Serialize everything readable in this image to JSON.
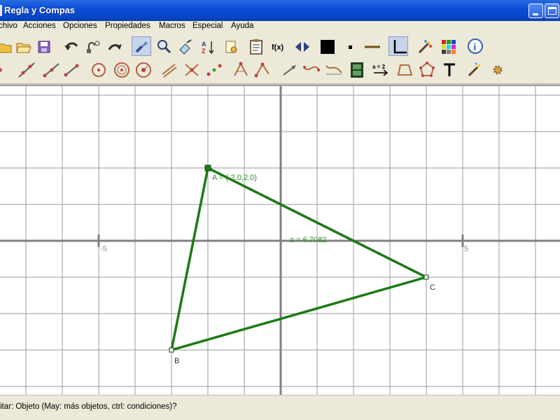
{
  "window": {
    "title": "Regla y Compas"
  },
  "menu": [
    "chivo",
    "Acciones",
    "Opciones",
    "Propiedades",
    "Macros",
    "Especial",
    "Ayuda"
  ],
  "toolbar": {
    "row1": [
      "open-icon",
      "folder-icon",
      "save-icon",
      "undo-icon",
      "hide-icon",
      "redo-icon",
      "edit-tool-icon",
      "zoom-move-icon",
      "label-tool-icon",
      "sort-icon",
      "properties-icon",
      "notes-icon",
      "function-icon",
      "reverse-icon",
      "color-icon",
      "point-size-icon",
      "line-thickness-icon",
      "axes-icon",
      "magic-wand-icon",
      "color-palette-icon",
      "info-icon"
    ],
    "row2": [
      "point-icon",
      "line-icon",
      "ray-icon",
      "segment-icon",
      "circle-icon",
      "fixed-circle-icon",
      "compass-circle-icon",
      "parallel-icon",
      "intersection-icon",
      "midpoint-icon",
      "angle-icon",
      "fixed-angle-icon",
      "vector-icon",
      "curve-icon",
      "function-plot-icon",
      "animation-icon",
      "expression-icon",
      "polygon-icon",
      "polygon-points-icon",
      "text-tool-icon",
      "hammer-tool-icon",
      "settings-gear-icon"
    ],
    "function_label": "f(x)",
    "expression_label": "a = 2"
  },
  "canvas": {
    "x_tick_neg": "-5",
    "x_tick_pos": "5",
    "point_A_label": "A = (-2.0,2.0)",
    "point_B_label": "B",
    "point_C_label": "C",
    "area_label": "a = 6.7082",
    "construction_color": "#1c7a14",
    "label_color": "#2e8a25"
  },
  "status": {
    "text": "itar: Objeto (May: más objetos, ctrl: condiciones)?"
  }
}
